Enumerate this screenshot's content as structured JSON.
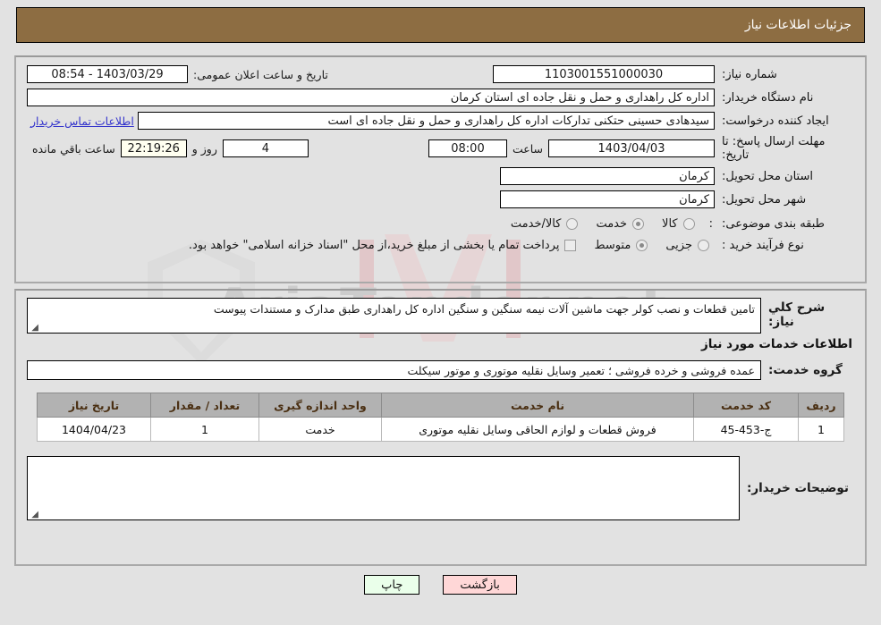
{
  "header": {
    "title": "جزئیات اطلاعات نیاز"
  },
  "form": {
    "need_number_label": "شماره نیاز:",
    "need_number_value": "1103001551000030",
    "announce_label": "تاریخ و ساعت اعلان عمومی:",
    "announce_value": "1403/03/29 - 08:54",
    "buyer_org_label": "نام دستگاه خریدار:",
    "buyer_org_value": "اداره کل راهداری و حمل و نقل جاده ای استان کرمان",
    "creator_label": "ایجاد کننده درخواست:",
    "creator_value": "سیدهادی حسینی حتکنی تدارکات اداره کل راهداری و حمل و نقل جاده ای است",
    "contact_link": "اطلاعات تماس خریدار",
    "deadline_label": "مهلت ارسال پاسخ: تا تاریخ:",
    "deadline_date": "1403/04/03",
    "deadline_hour_label": "ساعت",
    "deadline_hour": "08:00",
    "remaining_days": "4",
    "remaining_days_sep": "روز و",
    "remaining_time": "22:19:26",
    "remaining_suffix": "ساعت باقي مانده",
    "province_label": "استان محل تحویل:",
    "province_value": "کرمان",
    "city_label": "شهر محل تحویل:",
    "city_value": "کرمان",
    "category_label": "طبقه بندی موضوعی:",
    "category_colon": ":",
    "category_options": [
      {
        "label": "کالا",
        "selected": false
      },
      {
        "label": "خدمت",
        "selected": true
      },
      {
        "label": "کالا/خدمت",
        "selected": false
      }
    ],
    "process_label": "نوع فرآیند خرید :",
    "process_options": [
      {
        "label": "جزیی",
        "selected": false
      },
      {
        "label": "متوسط",
        "selected": true
      }
    ],
    "treasury_checkbox_label": "پرداخت تمام یا بخشی از مبلغ خرید،از محل \"اسناد خزانه اسلامی\" خواهد بود.",
    "treasury_checked": false
  },
  "details": {
    "desc_label": "شرح کلي نیاز:",
    "desc_value": "تامین قطعات و نصب کولر جهت ماشین آلات نیمه سنگین و سنگین اداره کل راهداری طبق مدارک و مستندات پیوست",
    "services_heading": "اطلاعات خدمات مورد نیاز",
    "group_label": "گروه خدمت:",
    "group_value": "عمده فروشی و خرده فروشی ؛ تعمیر وسایل نقلیه موتوری و موتور سیکلت",
    "table": {
      "columns": [
        "ردیف",
        "کد خدمت",
        "نام خدمت",
        "واحد اندازه گیری",
        "تعداد / مقدار",
        "تاریخ نیاز"
      ],
      "rows": [
        {
          "index": "1",
          "code": "ج-453-45",
          "name": "فروش قطعات و لوازم الحاقی وسایل نقلیه موتوری",
          "unit": "خدمت",
          "qty": "1",
          "date": "1404/04/23"
        }
      ]
    },
    "comment_label": "توضیحات خریدار:",
    "comment_value": ""
  },
  "buttons": {
    "print": "چاپ",
    "back": "بازگشت"
  },
  "watermark": {
    "text": "AriaTender.net"
  },
  "colors": {
    "header_bar": "#8d6d42",
    "page_bg": "#e2e2e2",
    "link": "#3333cc",
    "table_header": "#b2b2b2",
    "print_btn": "#eaffea",
    "back_btn": "#ffd7d7",
    "timer_field": "#fffff0"
  }
}
